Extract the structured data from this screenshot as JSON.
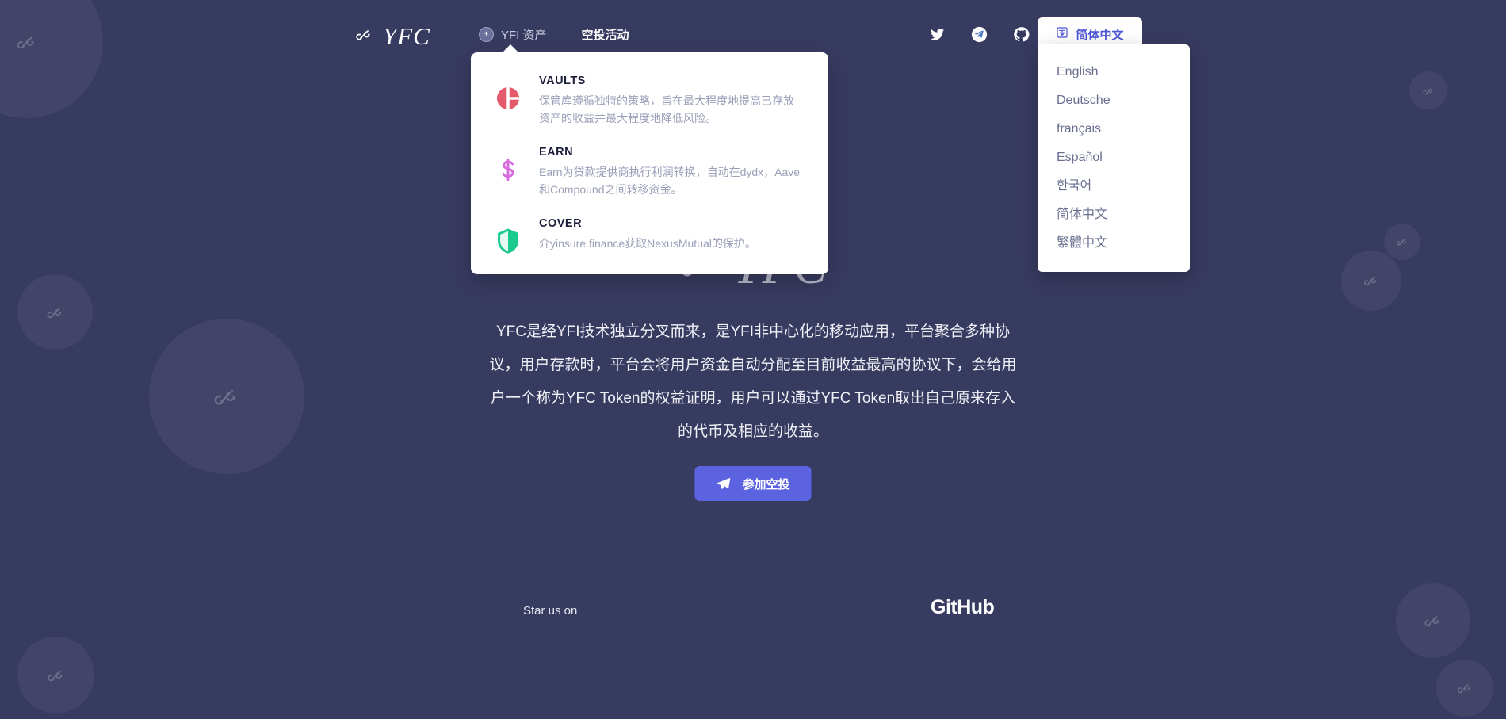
{
  "theme": {
    "background": "#383b60",
    "panel_bg": "#ffffff",
    "accent": "#5b63e0",
    "lang_accent": "#4b55d6",
    "muted_text": "#9b9fb8",
    "vaults_icon_color": "#e45a6a",
    "earn_icon_color": "#d86ae0",
    "cover_icon_color": "#19c98f"
  },
  "header": {
    "brand": {
      "text": "YFC",
      "icon": "yfc-link-logo-icon"
    },
    "nav": [
      {
        "label": "YFI 资产",
        "active": false,
        "badge_icon": "info-badge-icon"
      },
      {
        "label": "空投活动",
        "active": true
      }
    ],
    "social": [
      {
        "name": "twitter-icon",
        "title": "Twitter"
      },
      {
        "name": "telegram-icon",
        "title": "Telegram"
      },
      {
        "name": "github-icon",
        "title": "GitHub"
      }
    ],
    "language": {
      "selected": "简体中文",
      "icon": "language-globe-icon",
      "options": [
        "English",
        "Deutsche",
        "français",
        "Español",
        "한국어",
        "简体中文",
        "繁體中文"
      ]
    }
  },
  "products_dropdown": {
    "items": [
      {
        "title": "VAULTS",
        "description": "保管库遵循独特的策略，旨在最大程度地提高已存放资产的收益并最大程度地降低风险。",
        "icon": "vaults-pie-icon"
      },
      {
        "title": "EARN",
        "description": "Earn为贷款提供商执行利润转换，自动在dydx，Aave和Compound之间转移资金。",
        "icon": "earn-dollar-icon"
      },
      {
        "title": "COVER",
        "description": "介yinsure.finance获取NexusMutual的保护。",
        "icon": "cover-shield-icon"
      }
    ]
  },
  "watermark": {
    "text": "YFC",
    "icon": "yfc-link-logo-icon"
  },
  "main": {
    "paragraph": "YFC是经YFI技术独立分叉而来，是YFI非中心化的移动应用，平台聚合多种协议，用户存款时，平台会将用户资金自动分配至目前收益最高的协议下，会给用户一个称为YFC Token的权益证明，用户可以通过YFC Token取出自己原来存入的代币及相应的收益。"
  },
  "cta": {
    "label": "参加空投",
    "icon": "paper-plane-icon"
  },
  "footer": {
    "star_text": "Star us on",
    "github_label": "GitHub"
  }
}
